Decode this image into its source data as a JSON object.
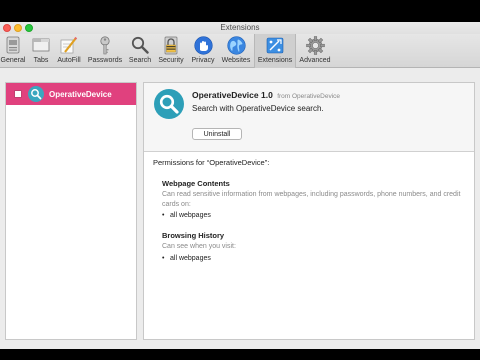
{
  "window": {
    "title": "Extensions"
  },
  "toolbar": {
    "items": [
      {
        "label": "General",
        "icon": "general-icon"
      },
      {
        "label": "Tabs",
        "icon": "tabs-icon"
      },
      {
        "label": "AutoFill",
        "icon": "autofill-icon"
      },
      {
        "label": "Passwords",
        "icon": "passwords-icon"
      },
      {
        "label": "Search",
        "icon": "search-icon"
      },
      {
        "label": "Security",
        "icon": "security-icon"
      },
      {
        "label": "Privacy",
        "icon": "privacy-icon"
      },
      {
        "label": "Websites",
        "icon": "websites-icon"
      },
      {
        "label": "Extensions",
        "icon": "extensions-icon",
        "selected": true
      },
      {
        "label": "Advanced",
        "icon": "advanced-icon"
      }
    ]
  },
  "sidebar": {
    "extensions": [
      {
        "name": "OperativeDevice",
        "enabled": false,
        "selected": true,
        "accent": "#e0417e"
      }
    ]
  },
  "detail": {
    "name_version": "OperativeDevice 1.0",
    "from": "from OperativeDevice",
    "description": "Search with OperativeDevice search.",
    "uninstall_label": "Uninstall",
    "permissions_title": "Permissions for “OperativeDevice”:",
    "sections": [
      {
        "heading": "Webpage Contents",
        "description": "Can read sensitive information from webpages, including passwords, phone numbers, and credit cards on:",
        "items": [
          "all webpages"
        ]
      },
      {
        "heading": "Browsing History",
        "description": "Can see when you visit:",
        "items": [
          "all webpages"
        ]
      }
    ]
  },
  "colors": {
    "accent": "#e0417e",
    "logo": "#2d9fb8"
  }
}
